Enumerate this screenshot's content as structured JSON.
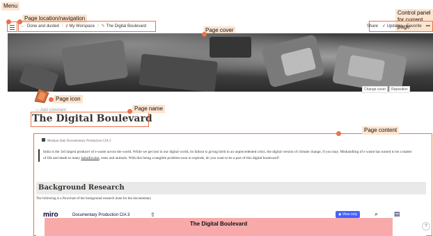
{
  "annotations": {
    "menu": "Menu",
    "location": "Page location/navigation",
    "cover": "Page cover",
    "control": "Control panel for current page",
    "icon": "Page icon",
    "name": "Page name",
    "content": "Page content"
  },
  "breadcrumbs": [
    "Done and dusted",
    "My Worspace",
    "The Digital Boulevard"
  ],
  "controls": {
    "share": "Share",
    "updates": "Updates",
    "favorite": "Favorite",
    "more": "•••"
  },
  "cover_buttons": {
    "change": "Change cover",
    "reposition": "Reposition"
  },
  "page": {
    "add_comment": "Add comment",
    "title": "The Digital Boulevard",
    "author": "Muskan Jain| Documentary Production CIA 3",
    "quote_pre": "India is the 3rd largest producer of e waste across the world. While we get lost in our digital world, its fallout is giving birth to an unprecedented crisis, the digital version of climate change, if you may. Mishandling of e waste has turned to be a matter of life and death to many ",
    "quote_link": "kabadiwalas",
    "quote_post": ", trees and animals. With this being a tangible problem soon to explode, do you want to be a part of this digital boulevard?",
    "h2": "Background Research",
    "para": "The following is a flowchart of the background research done for the documentary"
  },
  "miro": {
    "logo": "miro",
    "board_title": "Documentary Production CIA 3",
    "view_only": "View only",
    "canvas_title": "The Digital Boulevard"
  },
  "help": "?"
}
